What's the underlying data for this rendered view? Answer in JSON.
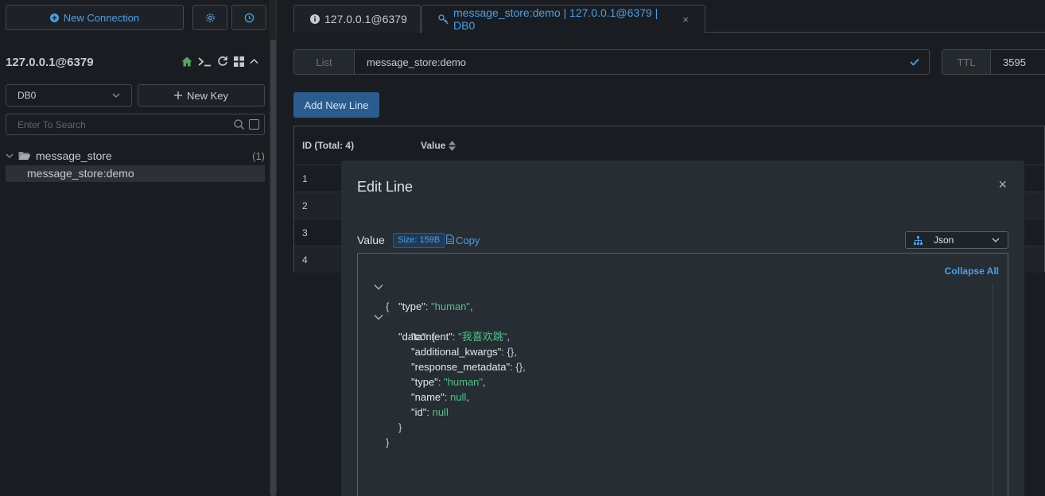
{
  "sidebar": {
    "new_connection_label": "New Connection",
    "connection_name": "127.0.0.1@6379",
    "db_selected": "DB0",
    "new_key_label": "New Key",
    "search_placeholder": "Enter To Search",
    "tree": {
      "folder_name": "message_store",
      "folder_count": "(1)",
      "item": "message_store:demo"
    }
  },
  "tabs": [
    {
      "label": "127.0.0.1@6379"
    },
    {
      "label": "message_store:demo | 127.0.0.1@6379 | DB0",
      "close": "×"
    }
  ],
  "keybar": {
    "type": "List",
    "name": "message_store:demo",
    "ttl_label": "TTL",
    "ttl_value": "3595"
  },
  "add_line_label": "Add New Line",
  "table": {
    "col_id": "ID (Total: 4)",
    "col_value": "Value",
    "rows": [
      "1",
      "2",
      "3",
      "4"
    ]
  },
  "dialog": {
    "title": "Edit Line",
    "close": "×",
    "value_label": "Value",
    "size_badge": "Size: 159B",
    "copy_label": "Copy",
    "format": "Json",
    "collapse_all": "Collapse All",
    "json": {
      "type_key": "\"type\"",
      "type_val": "\"human\"",
      "data_key": "\"data\"",
      "content_key": "\"content\"",
      "content_val": "\"我喜欢跳\"",
      "kwargs_key": "\"additional_kwargs\"",
      "kwargs_val": "{}",
      "meta_key": "\"response_metadata\"",
      "meta_val": "{}",
      "type2_key": "\"type\"",
      "type2_val": "\"human\"",
      "name_key": "\"name\"",
      "name_val": "null",
      "id_key": "\"id\"",
      "id_val": "null"
    }
  },
  "colors": {
    "accent": "#4a9fe8",
    "string": "#4cc38a",
    "background": "#191d21",
    "dialog": "#262d33",
    "home_icon": "#56a55c"
  }
}
